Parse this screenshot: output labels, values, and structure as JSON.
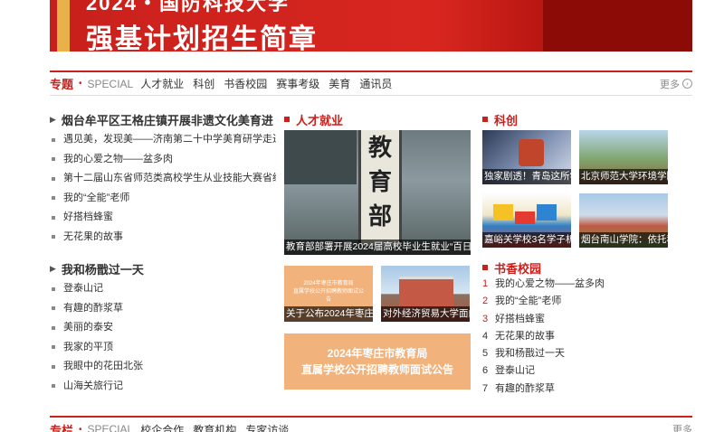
{
  "banner": {
    "top_text": "2024・国防科技大学",
    "main_text": "强基计划招生简章"
  },
  "topic_bar": {
    "lead": "专题",
    "dot": "•",
    "special": "SPECIAL",
    "nav": [
      "人才就业",
      "科创",
      "书香校园",
      "赛事考级",
      "美育",
      "通讯员"
    ],
    "more": "更多",
    "more_icon": "›"
  },
  "left_col": {
    "section1": {
      "arrow_icon": "▶",
      "title": "烟台牟平区王格庄镇开展非遗文化美育进",
      "items": [
        "遇见美，发现美——济南第二十中学美育研学走进济",
        "我的心爱之物——盆多肉",
        "第十二届山东省师范类高校学生从业技能大赛省级预",
        "我的“全能”老师",
        "好搭档蜂蜜",
        "无花果的故事"
      ]
    },
    "section2": {
      "arrow_icon": "▶",
      "title": "我和杨戬过一天",
      "items": [
        "登泰山记",
        "有趣的酢浆草",
        "美丽的泰安",
        "我家的平顶",
        "我眼中的花田北张",
        "山海关旅行记"
      ]
    }
  },
  "mid_col": {
    "title": "人才就业",
    "big_photo": {
      "plaque_chars": [
        "教",
        "育",
        "部"
      ],
      "caption": "教育部部署开展2024届高校毕业生就业“百日冲"
    },
    "small1": {
      "inner_lines": [
        "2024年枣庄市教育局",
        "直属学校公开招聘教师面试公告"
      ],
      "caption": "关于公布2024年枣庄市"
    },
    "small2": {
      "caption": "对外经济贸易大学面向"
    },
    "notice": {
      "line1": "2024年枣庄市教育局",
      "line2": "直属学校公开招聘教师面试公告"
    }
  },
  "right_col": {
    "kechuang_title": "科创",
    "photos": [
      "独家剧透！青岛这所学",
      "北京师范大学环境学院",
      "嘉峪关学校3名学子析",
      "烟台南山学院：依托科"
    ],
    "shuxiang_title": "书香校园",
    "rank": [
      {
        "num": "1",
        "text": "我的心爱之物——盆多肉"
      },
      {
        "num": "2",
        "text": "我的“全能”老师"
      },
      {
        "num": "3",
        "text": "好搭档蜂蜜"
      },
      {
        "num": "4",
        "text": "无花果的故事"
      },
      {
        "num": "5",
        "text": "我和杨戬过一天"
      },
      {
        "num": "6",
        "text": "登泰山记"
      },
      {
        "num": "7",
        "text": "有趣的酢浆草"
      }
    ]
  },
  "bottom_bar": {
    "lead": "专栏",
    "dot": "•",
    "special": "SPECIAL",
    "nav": [
      "校企合作",
      "教育机构",
      "专家访谈"
    ],
    "more": "更多"
  },
  "colors": {
    "accent": "#c9201c",
    "notice_bg": "#f2b27c"
  }
}
